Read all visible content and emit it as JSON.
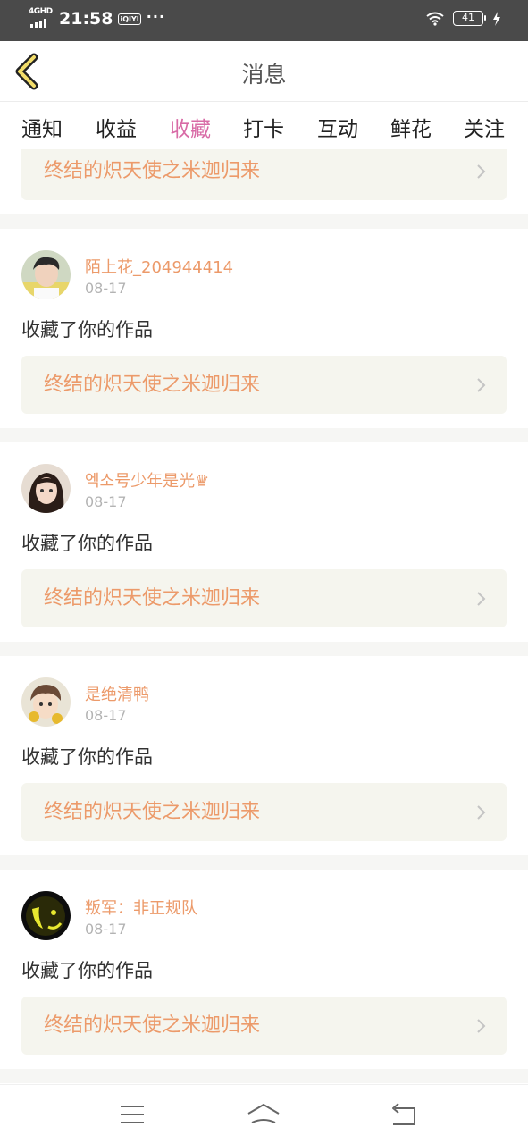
{
  "status_bar": {
    "network": "4GHD",
    "time": "21:58",
    "app_badge": "iQIYI",
    "more": "···",
    "battery": "41"
  },
  "header": {
    "title": "消息"
  },
  "tabs": [
    {
      "label": "通知"
    },
    {
      "label": "收益"
    },
    {
      "label": "收藏"
    },
    {
      "label": "打卡"
    },
    {
      "label": "互动"
    },
    {
      "label": "鲜花"
    },
    {
      "label": "关注"
    }
  ],
  "active_tab": "收藏",
  "colors": {
    "accent": "#d86ba6",
    "name_orange": "#ec9a6a",
    "link_bg": "#f5f5ee",
    "status_bar": "#4a4a4a"
  },
  "feed": {
    "partial_top": {
      "work_title": "终结的炽天使之米迦归来"
    },
    "items": [
      {
        "username": "陌上花_204944414",
        "date": "08-17",
        "action": "收藏了你的作品",
        "work_title": "终结的炽天使之米迦归来"
      },
      {
        "username": "엑소号少年是光♛",
        "date": "08-17",
        "action": "收藏了你的作品",
        "work_title": "终结的炽天使之米迦归来"
      },
      {
        "username": "是绝清鸭",
        "date": "08-17",
        "action": "收藏了你的作品",
        "work_title": "终结的炽天使之米迦归来"
      },
      {
        "username": "叛军：非正规队",
        "date": "08-17",
        "action": "收藏了你的作品",
        "work_title": "终结的炽天使之米迦归来"
      }
    ]
  },
  "icons": {
    "back": "chevron-left-icon",
    "menu": "menu-icon",
    "home": "home-icon",
    "return": "return-icon"
  }
}
